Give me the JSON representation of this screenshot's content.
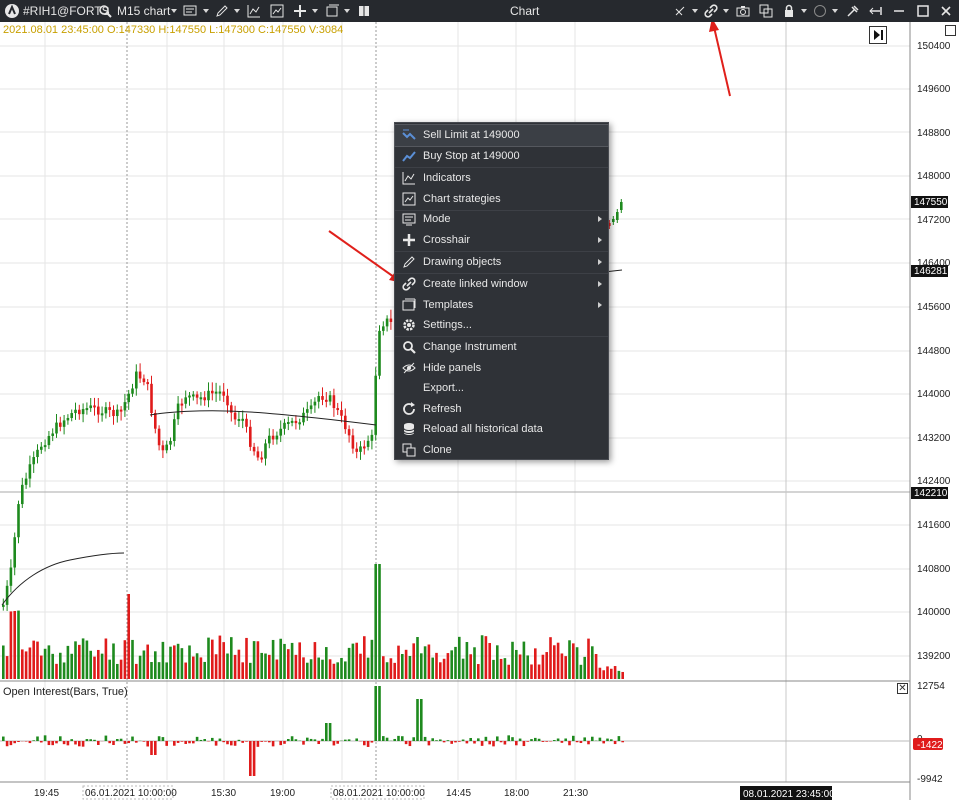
{
  "toolbar": {
    "symbol": "#RIH1@FORTS",
    "timeframe": "M15 chart",
    "title": "Chart"
  },
  "ohlc_readout": "2021.08.01 23:45:00 O:147330 H:147550 L:147300 C:147550 V:3084",
  "price_axis": {
    "ticks": [
      "150400",
      "149600",
      "148800",
      "148000",
      "147200",
      "146400",
      "145600",
      "144800",
      "144000",
      "143200",
      "142400",
      "141600",
      "140800",
      "140000",
      "139200"
    ],
    "current_price": "147550",
    "ma_value": "146281",
    "crosshair_price": "142210"
  },
  "oi_axis": {
    "ticks": [
      "12754",
      "0",
      "-9942"
    ],
    "current_value": "-1422"
  },
  "time_axis": {
    "ticks": [
      "19:45",
      "06.01.2021 10:00:00",
      "15:30",
      "19:00",
      "08.01.2021 10:00:00",
      "14:45",
      "18:00",
      "21:30"
    ],
    "cursor_time": "08.01.2021 23:45:00"
  },
  "indicator": {
    "title": "Open Interest(Bars, True)"
  },
  "context_menu": {
    "items": [
      {
        "label": "Sell Limit at 149000",
        "icon": "sell-limit-icon",
        "submenu": false
      },
      {
        "label": "Buy Stop at 149000",
        "icon": "buy-stop-icon",
        "submenu": false
      },
      {
        "label": "Indicators",
        "icon": "indicators-icon",
        "submenu": false
      },
      {
        "label": "Chart strategies",
        "icon": "strategies-icon",
        "submenu": false
      },
      {
        "label": "Mode",
        "icon": "mode-icon",
        "submenu": true
      },
      {
        "label": "Crosshair",
        "icon": "crosshair-icon",
        "submenu": true
      },
      {
        "label": "Drawing objects",
        "icon": "pencil-icon",
        "submenu": true
      },
      {
        "label": "Create linked window",
        "icon": "link-icon",
        "submenu": true
      },
      {
        "label": "Templates",
        "icon": "templates-icon",
        "submenu": true
      },
      {
        "label": "Settings...",
        "icon": "gear-icon",
        "submenu": false
      },
      {
        "label": "Change Instrument",
        "icon": "search-icon",
        "submenu": false
      },
      {
        "label": "Hide panels",
        "icon": "eye-icon",
        "submenu": false
      },
      {
        "label": "Export...",
        "icon": "",
        "submenu": false
      },
      {
        "label": "Refresh",
        "icon": "refresh-icon",
        "submenu": false
      },
      {
        "label": "Reload all historical data",
        "icon": "database-icon",
        "submenu": false
      },
      {
        "label": "Clone",
        "icon": "clone-icon",
        "submenu": false
      }
    ]
  },
  "colors": {
    "up": "#1e8a1e",
    "down": "#e01b1b",
    "ohlc_text": "#c8a000",
    "toolbar_bg": "#26292e",
    "menu_bg": "#2f3237",
    "annotation_arrow": "#e0201b"
  }
}
